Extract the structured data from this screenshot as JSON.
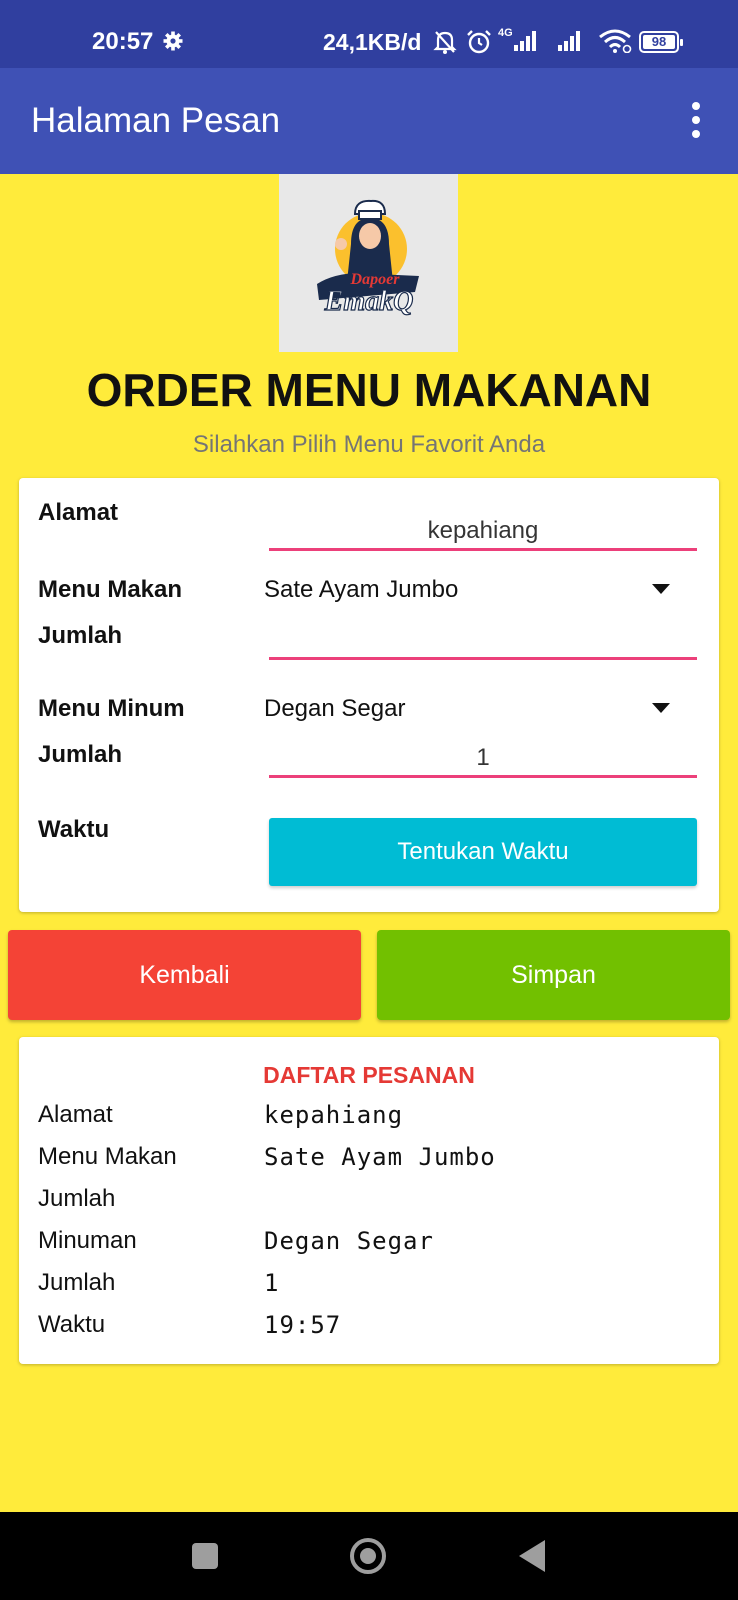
{
  "status_bar": {
    "time": "20:57",
    "net_speed": "24,1KB/d",
    "network_type": "4G",
    "battery": "98",
    "icons": [
      "settings-icon",
      "mute-icon",
      "alarm-icon",
      "signal-icon",
      "wifi-icon",
      "battery-icon"
    ]
  },
  "app_bar": {
    "title": "Halaman Pesan",
    "menu_icon": "more-vert-icon",
    "color": "#3F51B5"
  },
  "logo": {
    "text_top": "Dapoer",
    "text_bottom": "EmakQ"
  },
  "header": {
    "title": "ORDER MENU MAKANAN",
    "subtitle": "Silahkan Pilih Menu Favorit Anda"
  },
  "form": {
    "alamat_label": "Alamat",
    "alamat_value": "kepahiang",
    "menu_makan_label": "Menu Makan",
    "menu_makan_selected": "Sate Ayam Jumbo",
    "jumlah_makan_label": "Jumlah",
    "jumlah_makan_value": "",
    "menu_minum_label": "Menu Minum",
    "menu_minum_selected": "Degan Segar",
    "jumlah_minum_label": "Jumlah",
    "jumlah_minum_value": "1",
    "waktu_label": "Waktu",
    "waktu_button": "Tentukan Waktu"
  },
  "actions": {
    "back_label": "Kembali",
    "save_label": "Simpan"
  },
  "order_list": {
    "title": "DAFTAR PESANAN",
    "rows": [
      {
        "key": "Alamat",
        "value": "kepahiang"
      },
      {
        "key": "Menu Makan",
        "value": "Sate Ayam Jumbo"
      },
      {
        "key": "Jumlah",
        "value": ""
      },
      {
        "key": "Minuman",
        "value": "Degan Segar"
      },
      {
        "key": "Jumlah",
        "value": "1"
      },
      {
        "key": "Waktu",
        "value": "19:57"
      }
    ]
  },
  "colors": {
    "background": "#FFEB3B",
    "status_bar": "#303F9F",
    "input_underline": "#E91E63",
    "waktu_button": "#00BCD4",
    "back_button": "#F44336",
    "save_button": "#72C000",
    "list_title": "#E53935"
  }
}
